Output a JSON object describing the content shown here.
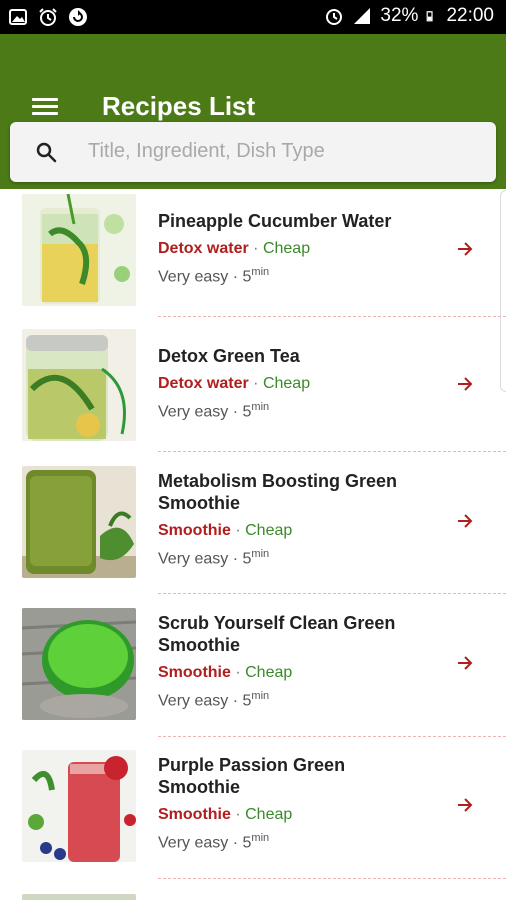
{
  "status_bar": {
    "battery": "32%",
    "time": "22:00",
    "left_icons": [
      "image-icon",
      "alarm-icon",
      "refresh-icon"
    ],
    "right_icons": [
      "alarm-icon",
      "signal-icon",
      "battery-icon"
    ]
  },
  "appbar": {
    "title": "Recipes List",
    "menu_icon": "hamburger-icon",
    "color": "#4b7a17"
  },
  "search": {
    "placeholder": "Title, Ingredient, Dish Type",
    "icon": "search-icon"
  },
  "recipes": [
    {
      "title": "Pineapple Cucumber Water",
      "category": "Detox water",
      "price": "Cheap",
      "difficulty": "Very easy",
      "time": "5",
      "time_unit": "min"
    },
    {
      "title": "Detox Green Tea",
      "category": "Detox water",
      "price": "Cheap",
      "difficulty": "Very easy",
      "time": "5",
      "time_unit": "min"
    },
    {
      "title": "Metabolism Boosting Green Smoothie",
      "category": "Smoothie",
      "price": "Cheap",
      "difficulty": "Very easy",
      "time": "5",
      "time_unit": "min"
    },
    {
      "title": "Scrub Yourself Clean Green Smoothie",
      "category": "Smoothie",
      "price": "Cheap",
      "difficulty": "Very easy",
      "time": "5",
      "time_unit": "min"
    },
    {
      "title": "Purple Passion Green Smoothie",
      "category": "Smoothie",
      "price": "Cheap",
      "difficulty": "Very easy",
      "time": "5",
      "time_unit": "min"
    }
  ],
  "separator": "·",
  "colors": {
    "category": "#b01e1e",
    "price": "#3a8a2a",
    "arrow": "#b01e1e"
  }
}
